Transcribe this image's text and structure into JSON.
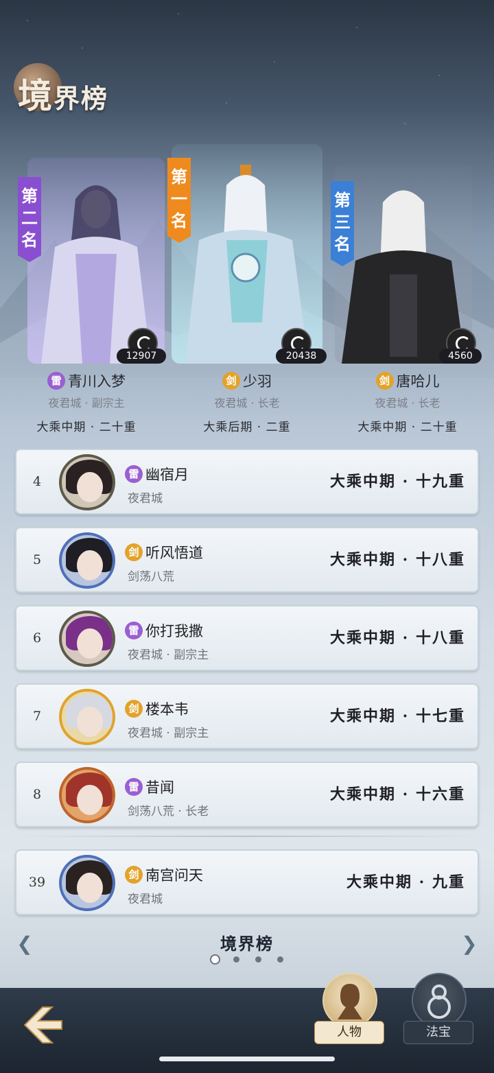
{
  "title": {
    "main": "境",
    "rest": "界榜"
  },
  "podium": [
    {
      "banner": "第二名",
      "banner_color": "#8a4fd0",
      "power": "12907",
      "element": "雷",
      "element_type": "thunder",
      "name": "青川入梦",
      "sect": "夜君城 · 副宗主",
      "realm": "大乘中期 · 二十重"
    },
    {
      "banner": "第一名",
      "banner_color": "#ef8a1e",
      "power": "20438",
      "element": "剑",
      "element_type": "sword",
      "name": "少羽",
      "sect": "夜君城 · 长老",
      "realm": "大乘后期 · 二重"
    },
    {
      "banner": "第三名",
      "banner_color": "#3b7fd6",
      "power": "4560",
      "element": "剑",
      "element_type": "sword",
      "name": "唐哈儿",
      "sect": "夜君城 · 长老",
      "realm": "大乘中期 · 二十重"
    }
  ],
  "rows": [
    {
      "rank": "4",
      "element": "雷",
      "element_type": "thunder",
      "name": "幽宿月",
      "sect": "夜君城",
      "realm": "大乘中期 · 十九重",
      "hair": "#2a2222"
    },
    {
      "rank": "5",
      "element": "剑",
      "element_type": "sword",
      "name": "听风悟道",
      "sect": "剑荡八荒",
      "realm": "大乘中期 · 十八重",
      "hair": "#1e1e24"
    },
    {
      "rank": "6",
      "element": "雷",
      "element_type": "thunder",
      "name": "你打我撒",
      "sect": "夜君城 · 副宗主",
      "realm": "大乘中期 · 十八重",
      "hair": "#7a2f88"
    },
    {
      "rank": "7",
      "element": "剑",
      "element_type": "sword",
      "name": "楼本韦",
      "sect": "夜君城 · 副宗主",
      "realm": "大乘中期 · 十七重",
      "hair": "#d7d9e2"
    },
    {
      "rank": "8",
      "element": "雷",
      "element_type": "thunder",
      "name": "昔闻",
      "sect": "剑荡八荒 · 长老",
      "realm": "大乘中期 · 十六重",
      "hair": "#a0342a"
    }
  ],
  "self_row": {
    "rank": "39",
    "element": "剑",
    "element_type": "sword",
    "name": "南宫问天",
    "sect": "夜君城",
    "realm": "大乘中期 · 九重",
    "hair": "#2a2220"
  },
  "pager": {
    "title": "境界榜",
    "pages": 4,
    "active": 0
  },
  "tabs": {
    "character": "人物",
    "treasure": "法宝"
  }
}
